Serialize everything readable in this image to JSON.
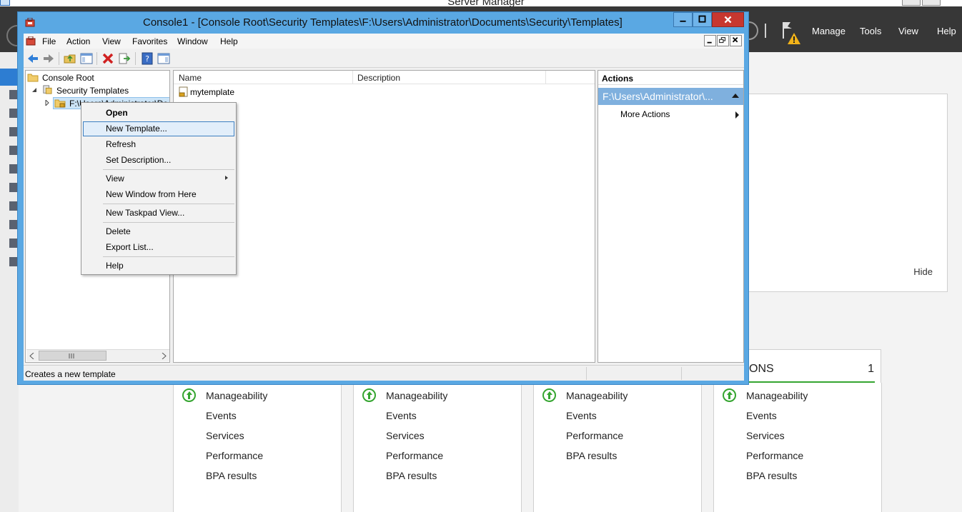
{
  "server_manager": {
    "title": "Server Manager",
    "menus": [
      "Manage",
      "Tools",
      "View",
      "Help"
    ],
    "welcome_hide": "Hide",
    "tile_heading_partial": "ONS",
    "tile_count": "1",
    "tiles": [
      {
        "rows": [
          "Manageability",
          "Events",
          "Services",
          "Performance",
          "BPA results"
        ]
      },
      {
        "rows": [
          "Manageability",
          "Events",
          "Services",
          "Performance",
          "BPA results"
        ]
      },
      {
        "rows": [
          "Manageability",
          "Events",
          "Performance",
          "BPA results"
        ]
      },
      {
        "rows": [
          "Manageability",
          "Events",
          "Services",
          "Performance",
          "BPA results"
        ]
      }
    ]
  },
  "mmc": {
    "title": "Console1 - [Console Root\\Security Templates\\F:\\Users\\Administrator\\Documents\\Security\\Templates]",
    "menubar": [
      "File",
      "Action",
      "View",
      "Favorites",
      "Window",
      "Help"
    ],
    "tree": {
      "root": "Console Root",
      "child": "Security Templates",
      "selected": "F:\\Users\\Administrator\\Documents\\Security\\Templates"
    },
    "list": {
      "columns": [
        "Name",
        "Description"
      ],
      "rows": [
        {
          "name": "mytemplate",
          "description": ""
        }
      ]
    },
    "actions": {
      "title": "Actions",
      "section": "F:\\Users\\Administrator\\...",
      "more": "More Actions"
    },
    "status": "Creates a new template",
    "context_menu": {
      "items": [
        {
          "label": "Open",
          "bold": true
        },
        {
          "label": "New Template...",
          "highlighted": true
        },
        {
          "label": "Refresh"
        },
        {
          "label": "Set Description..."
        },
        {
          "label": "View",
          "submenu": true
        },
        {
          "label": "New Window from Here"
        },
        {
          "label": "New Taskpad View..."
        },
        {
          "label": "Delete"
        },
        {
          "label": "Export List..."
        },
        {
          "label": "Help"
        }
      ]
    }
  },
  "colors": {
    "titlebar_blue": "#5aa8e3",
    "close_red": "#c7372f",
    "header_dark": "#373737",
    "ok_green": "#35a530",
    "actions_section": "#7fb0de"
  }
}
